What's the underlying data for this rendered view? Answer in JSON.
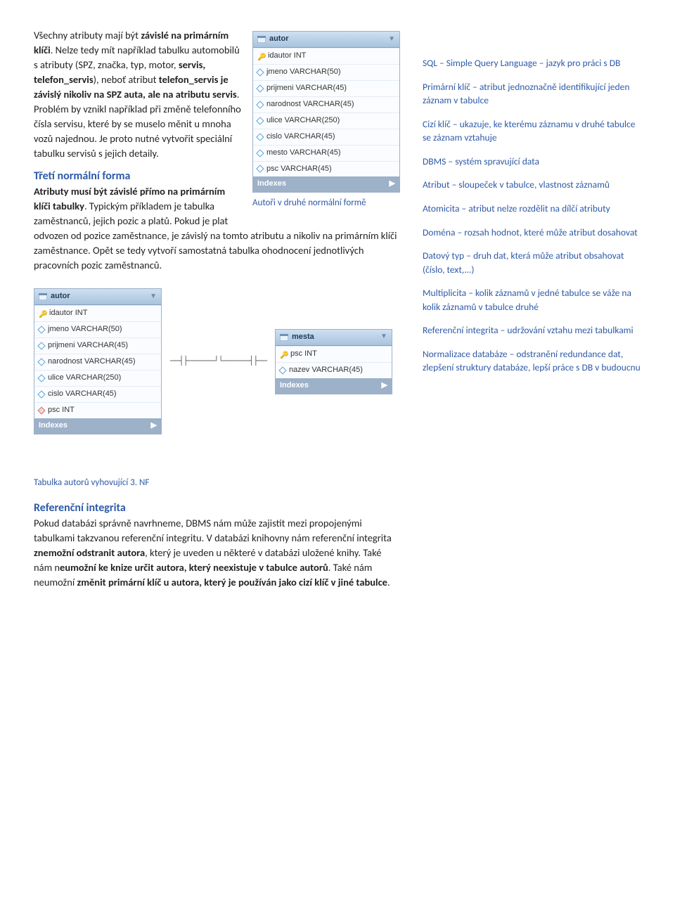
{
  "para1": {
    "lead": "Všechny atributy mají být ",
    "bold1": "závislé na primárním klíči",
    "tail": ". Nelze tedy mít například tabulku automobilů s atributy (SPZ, značka, typ, motor, ",
    "bold2": "servis, telefon_servis",
    "r2": "), neboť atribut ",
    "bold3": "telefon_servis je závislý nikoliv na SPZ auta, ale na atributu servis",
    "r3": ". Problém by vznikl například při změně telefonního čísla servisu, které by se muselo měnit u mnoha vozů najednou. Je proto nutné vytvořit speciální tabulku servisů s jejich detaily."
  },
  "h_third": "Třetí normální forma",
  "para2": {
    "bold1": "Atributy musí být závislé přímo na primárním klíči tabulky",
    "r1": ". Typickým příkladem je tabulka zaměstnanců, jejich pozic a platů. Pokud je plat odvozen od pozice zaměstnance, je závislý na tomto atributu a nikoliv na primárním klíči zaměstnance. Opět se tedy vytvoří samostatná tabulka ohodnocení jednotlivých pracovních pozic zaměstnanců."
  },
  "fig1_caption": "Autoři v druhé normální formě",
  "fig2_caption": "Tabulka autorů vyhovující 3. NF",
  "autor1": {
    "title": "autor",
    "rows": [
      {
        "k": "key",
        "t": "idautor INT"
      },
      {
        "k": "dia",
        "t": "jmeno VARCHAR(50)"
      },
      {
        "k": "dia",
        "t": "prijmeni VARCHAR(45)"
      },
      {
        "k": "dia",
        "t": "narodnost VARCHAR(45)"
      },
      {
        "k": "dia",
        "t": "ulice VARCHAR(250)"
      },
      {
        "k": "dia",
        "t": "cislo VARCHAR(45)"
      },
      {
        "k": "dia",
        "t": "mesto VARCHAR(45)"
      },
      {
        "k": "dia",
        "t": "psc VARCHAR(45)"
      }
    ],
    "idx": "Indexes"
  },
  "autor2": {
    "title": "autor",
    "rows": [
      {
        "k": "key",
        "t": "idautor INT"
      },
      {
        "k": "dia",
        "t": "jmeno VARCHAR(50)"
      },
      {
        "k": "dia",
        "t": "prijmeni VARCHAR(45)"
      },
      {
        "k": "dia",
        "t": "narodnost VARCHAR(45)"
      },
      {
        "k": "dia",
        "t": "ulice VARCHAR(250)"
      },
      {
        "k": "dia",
        "t": "cislo VARCHAR(45)"
      },
      {
        "k": "fk",
        "t": "psc INT"
      }
    ],
    "idx": "Indexes"
  },
  "mesta": {
    "title": "mesta",
    "rows": [
      {
        "k": "key",
        "t": "psc INT"
      },
      {
        "k": "dia",
        "t": "nazev VARCHAR(45)"
      }
    ],
    "idx": "Indexes"
  },
  "rel_conn": "──┤├──────┘└──────┤├──",
  "h_ref": "Referenční integrita",
  "para3": {
    "r1": "Pokud databázi správně navrhneme, DBMS nám může zajistit mezi propojenými tabulkami takzvanou referenční integritu. V databázi knihovny nám referenční integrita ",
    "b1": "znemožní odstranit autora",
    "r2": ", který je uveden u některé v databázi uložené knihy. Také nám n",
    "b2": "eumožní ke knize určit autora, který neexistuje v tabulce autorů",
    "r3": ". Také nám neumožní ",
    "b3": "změnit primární klíč u autora, který je používán jako cizí klíč v jiné tabulce",
    "r4": "."
  },
  "gloss": [
    "SQL – Simple Query Language – jazyk pro práci s DB",
    "Primární klíč – atribut jednoznačně identifikující jeden záznam v tabulce",
    "Cizí klíč – ukazuje, ke kterému záznamu v druhé tabulce se záznam vztahuje",
    "DBMS – systém spravující data",
    "Atribut – sloupeček v tabulce, vlastnost záznamů",
    "Atomicita – atribut nelze rozdělit na dílčí atributy",
    "Doména – rozsah hodnot, které může atribut dosahovat",
    "Datový typ – druh dat, která může atribut obsahovat (číslo, text,...)",
    "Multiplicita – kolik záznamů v jedné tabulce se váže na kolik záznamů v tabulce druhé",
    "Referenční integrita – udržování vztahu mezi tabulkami",
    "Normalizace databáze – odstranění redundance dat, zlepšení struktury databáze, lepší práce s DB v budoucnu"
  ]
}
